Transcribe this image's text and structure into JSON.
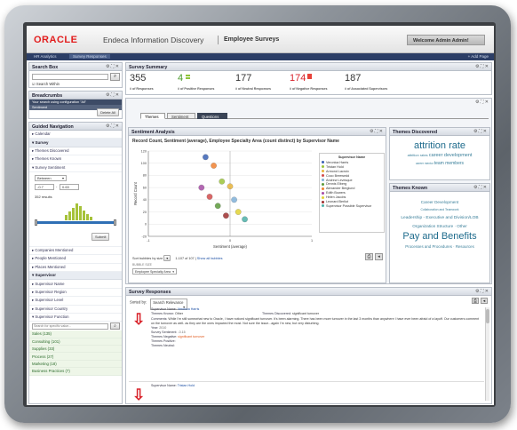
{
  "brand": {
    "logo": "ORACLE",
    "product": "Endeca Information Discovery",
    "app": "Employee Surveys",
    "welcome": "Welcome Admin Admin!"
  },
  "tabs": [
    "HR Analytics",
    "Survey Responses"
  ],
  "add_page": "+ Add Page",
  "search_box": {
    "title": "Search Box",
    "search_within": "Search Within"
  },
  "breadcrumbs": {
    "title": "Breadcrumbs",
    "item1": "Your search using configuration \"All\"",
    "item2": "Sentiment",
    "delete_all": "Delete All"
  },
  "guided_nav": {
    "title": "Guided Navigation",
    "items_top": [
      "Calendar",
      "Survey"
    ],
    "sub_items": [
      "Themes Discovered",
      "Themes Known",
      "Survey Sentiment"
    ],
    "range_type": "Between",
    "range_from": "-0.7",
    "range_to": "0.63",
    "results": "352 results",
    "submit": "Submit",
    "items_mid": [
      "Companies Mentioned",
      "People Mentioned",
      "Places Mentioned"
    ],
    "supervisor": "Supervisor",
    "supervisor_items": [
      "Supervisor Name",
      "Supervisor Region",
      "Supervisor Level",
      "Supervisor Country",
      "Supervisor Function"
    ],
    "search_placeholder": "Search for specific value...",
    "functions": [
      "Sales (135)",
      "Consulting (101)",
      "Supplies (33)",
      "Process (27)",
      "Marketing (18)",
      "Business Practices (7)"
    ]
  },
  "summary": {
    "title": "Survey Summary",
    "stats": [
      {
        "value": "355",
        "label": "# of Responses"
      },
      {
        "value": "4",
        "label": "# of Positive Responses"
      },
      {
        "value": "177",
        "label": "# of Neutral Responses"
      },
      {
        "value": "174",
        "label": "# of Negative Responses"
      },
      {
        "value": "187",
        "label": "# of Associated Supervisors"
      }
    ]
  },
  "content_tabs": [
    "Themes",
    "Sentiment",
    "Questions"
  ],
  "sentiment": {
    "title": "Sentiment Analysis",
    "chart_title": "Record Count, Sentiment (average), Employee Specialty Area (count distinct) by Supervisor Name",
    "legend_title": "Supervisor Name",
    "footer_sort": "Sort bubbles by size",
    "footer_count": "1-107 of 107",
    "footer_show": "Show all bubbles",
    "bubble_size_label": "BUBBLE SIZE",
    "bubble_size_value": "Employee Specialty Area"
  },
  "chart_data": {
    "type": "scatter",
    "xlabel": "Sentiment (average)",
    "ylabel": "Record Count",
    "xlim": [
      -1,
      1
    ],
    "ylim": [
      -20,
      120
    ],
    "yticks": [
      120,
      100,
      80,
      60,
      40,
      20,
      0,
      -20
    ],
    "xticks": [
      -1,
      0,
      1
    ],
    "series": [
      {
        "name": "Veronica Harris",
        "color": "#3a62b4",
        "points": [
          [
            -0.3,
            110
          ]
        ]
      },
      {
        "name": "Tristan Hold",
        "color": "#9bc43a",
        "points": [
          [
            -0.1,
            70
          ]
        ]
      },
      {
        "name": "Armond Lacroix",
        "color": "#e8b43a",
        "points": [
          [
            0.0,
            62
          ]
        ]
      },
      {
        "name": "Coco Breewedd",
        "color": "#d24c4c",
        "points": [
          [
            -0.25,
            45
          ]
        ]
      },
      {
        "name": "Andrew Levesque",
        "color": "#7fb0d8",
        "points": [
          [
            0.05,
            40
          ]
        ]
      },
      {
        "name": "Dennis Elberg",
        "color": "#5c9a3c",
        "points": [
          [
            -0.15,
            30
          ]
        ]
      },
      {
        "name": "Alexander Berglund",
        "color": "#f08030",
        "points": [
          [
            -0.2,
            96
          ]
        ]
      },
      {
        "name": "Edith Bowers",
        "color": "#a64ca6",
        "points": [
          [
            -0.35,
            60
          ]
        ]
      },
      {
        "name": "Helen Jacobs",
        "color": "#e2d235",
        "points": [
          [
            0.1,
            20
          ]
        ]
      },
      {
        "name": "Leonard Berliot",
        "color": "#9e2f2f",
        "points": [
          [
            -0.05,
            14
          ]
        ]
      },
      {
        "name": "Supervisor Possible Supervisor",
        "color": "#4cb0a8",
        "points": [
          [
            0.18,
            8
          ]
        ]
      }
    ]
  },
  "themes_discovered": {
    "title": "Themes Discovered",
    "words": [
      "attrition rate",
      "attrition rates",
      "career development",
      "career mentor",
      "team members"
    ]
  },
  "themes_known": {
    "title": "Themes Known",
    "words": [
      "Career Development",
      "Collaboration and Teamwork",
      "Leadership - Executive and Division/LOB",
      "Organization Structure",
      "Other",
      "Pay and Benefits",
      "Processes and Procedures",
      "Resources"
    ]
  },
  "responses": {
    "title": "Survey Responses",
    "sorted_by": "Sorted by:",
    "sort_value": "Search Relevance",
    "r1": {
      "supervisor_label": "Supervisor Name:",
      "supervisor": "Veronica Harris",
      "themes_known_label": "Themes Known:",
      "themes_known": "Other",
      "themes_disc_label": "Themes Discovered:",
      "themes_disc": "significant turnover",
      "comments_label": "Comments:",
      "comments": "While I'm still somewhat new to Oracle, I have noticed significant turnover. It's been alarming. There has been more turnover in the last 3 months than anywhere I have ever been afraid of a layoff. Our customers comment on the turnover as well- as they are the ones impacted the most. Not sure the issue...again I'm new, but very disturbing.",
      "year_label": "Year:",
      "year": "2010",
      "sentiment_label": "Survey Sentiment:",
      "sentiment": "-0.15",
      "neg_label": "Themes Negative:",
      "neg": "significant turnover",
      "pos_label": "Themes Positive:",
      "neu_label": "Themes Neutral:"
    },
    "r2": {
      "supervisor_label": "Supervisor Name:",
      "supervisor": "Tristan Hold"
    }
  }
}
